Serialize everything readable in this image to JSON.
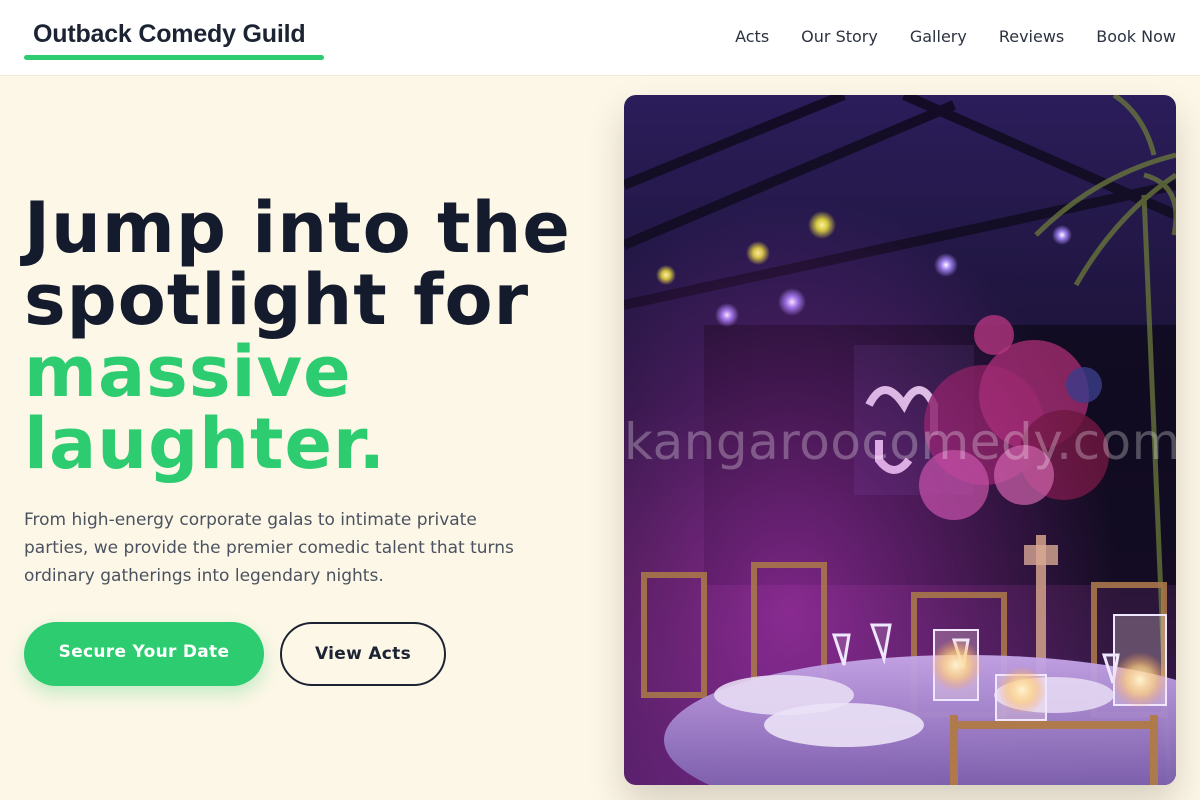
{
  "brand": {
    "name": "Outback Comedy Guild",
    "accent": "#2ecc71"
  },
  "nav": {
    "items": [
      "Acts",
      "Our Story",
      "Gallery",
      "Reviews",
      "Book Now"
    ]
  },
  "hero": {
    "title_line1": "Jump into the",
    "title_line2": "spotlight for",
    "title_accent_line1": "massive",
    "title_accent_line2": "laughter.",
    "subtitle": "From high-energy corporate galas to intimate private parties, we provide the premier comedic talent that turns ordinary gatherings into legendary nights.",
    "primary_cta": "Secure Your Date",
    "secondary_cta": "View Acts"
  },
  "image": {
    "watermark": "kangaroocomedy.com"
  },
  "colors": {
    "background": "#fdf7e7",
    "text_dark": "#141b2d",
    "muted": "#4b5260"
  }
}
